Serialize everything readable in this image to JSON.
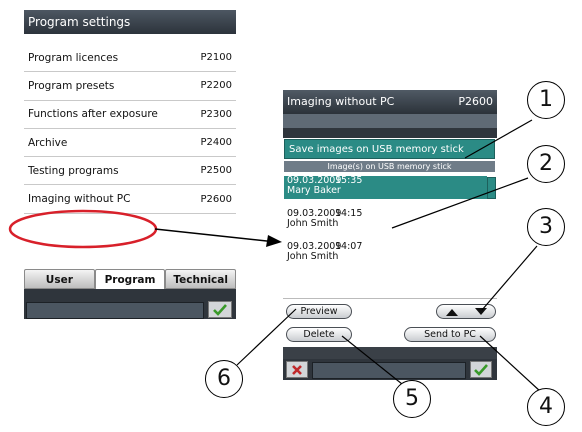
{
  "program_settings": {
    "title": "Program settings",
    "items": [
      {
        "label": "Program licences",
        "code": "P2100"
      },
      {
        "label": "Program presets",
        "code": "P2200"
      },
      {
        "label": "Functions after exposure",
        "code": "P2300"
      },
      {
        "label": "Archive",
        "code": "P2400"
      },
      {
        "label": "Testing programs",
        "code": "P2500"
      },
      {
        "label": "Imaging without PC",
        "code": "P2600"
      }
    ],
    "tabs": [
      "User",
      "Program",
      "Technical"
    ],
    "active_tab": "Program"
  },
  "imaging": {
    "title": "Imaging without PC",
    "code": "P2600",
    "save_button": "Save images on USB memory stick",
    "list_header": "Image(s) on USB memory stick",
    "records": [
      {
        "date": "09.03.2009",
        "time": "15:35",
        "name": "Mary Baker",
        "selected": true
      },
      {
        "date": "09.03.2009",
        "time": "14:15",
        "name": "John Smith",
        "selected": false
      },
      {
        "date": "09.03.2009",
        "time": "14:07",
        "name": "John Smith",
        "selected": false
      }
    ],
    "preview_button": "Preview",
    "delete_button": "Delete",
    "send_button": "Send to PC"
  },
  "callouts": [
    "1",
    "2",
    "3",
    "4",
    "5",
    "6"
  ],
  "colors": {
    "accent": "#2b8b85",
    "highlight_ring": "#d8202a",
    "title_bar": "#2c333b",
    "ok_check": "#3a9a2a",
    "cancel_x": "#c0282a"
  },
  "icons": {
    "ok": "check-icon",
    "cancel": "close-icon",
    "up": "arrow-up-icon",
    "down": "arrow-down-icon"
  }
}
